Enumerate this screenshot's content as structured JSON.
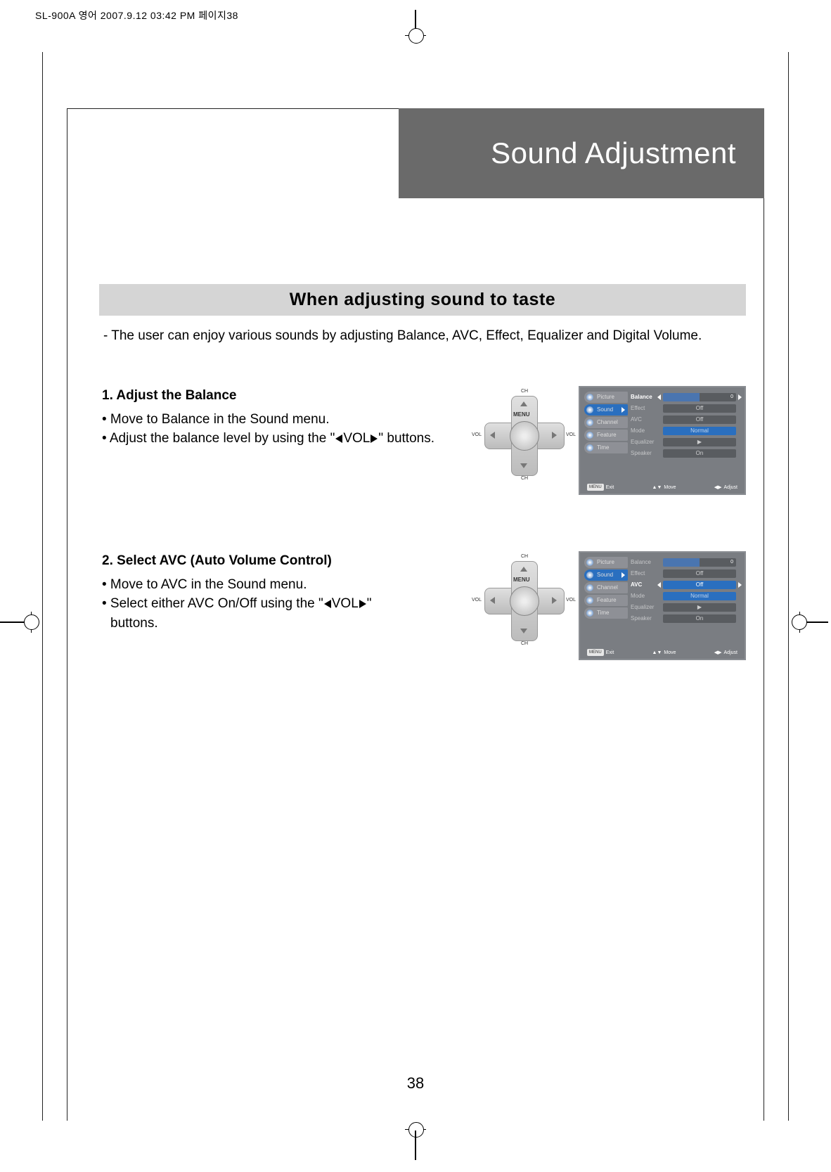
{
  "printHeader": "SL-900A 영어  2007.9.12 03:42 PM 페이지38",
  "title": "Sound Adjustment",
  "sectionHeader": "When adjusting sound to taste",
  "intro": "- The user can enjoy various sounds by adjusting Balance, AVC, Effect, Equalizer and Digital Volume.",
  "step1": {
    "heading": "1. Adjust the Balance",
    "b1": "• Move to Balance in the Sound menu.",
    "b2a": "• Adjust the balance level by using the \"",
    "vol": "VOL",
    "b2b": "\" buttons."
  },
  "step2": {
    "heading": "2. Select AVC (Auto Volume Control)",
    "b1": "• Move to AVC in the Sound menu.",
    "b2a": "• Select either AVC On/Off using the \"",
    "vol": "VOL",
    "b2b": "\"",
    "b3": "buttons."
  },
  "dpad": {
    "menu": "MENU",
    "ch": "CH",
    "vol": "VOL"
  },
  "osd": {
    "tabs": {
      "picture": "Picture",
      "sound": "Sound",
      "channel": "Channel",
      "feature": "Feature",
      "time": "Time"
    },
    "rows": {
      "balance": "Balance",
      "effect": "Effect",
      "avc": "AVC",
      "mode": "Mode",
      "equalizer": "Equalizer",
      "speaker": "Speaker"
    },
    "vals": {
      "zero": "0",
      "off": "Off",
      "normal": "Normal",
      "arrow": "▶",
      "on": "On"
    },
    "footer": {
      "menu": "MENU",
      "exit": "Exit",
      "move": "Move",
      "adjust": "Adjust",
      "arrows_v": "▲▼",
      "arrows_h": "◀▶"
    }
  },
  "pageNum": "38"
}
